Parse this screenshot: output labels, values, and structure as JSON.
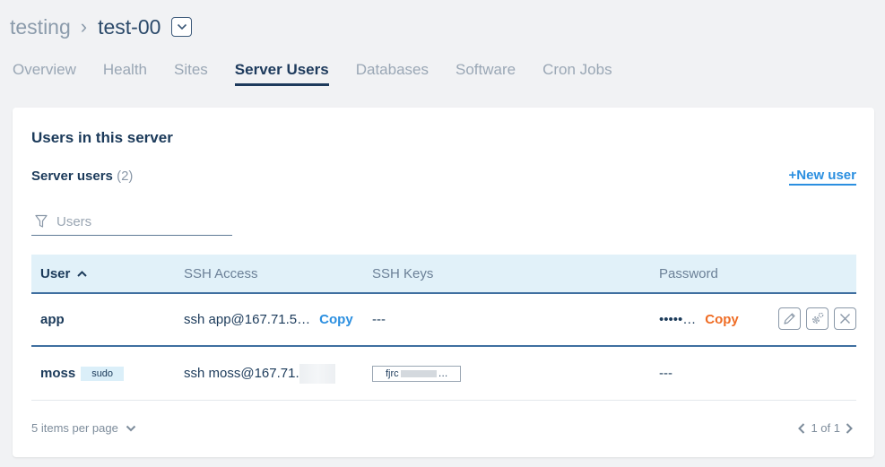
{
  "breadcrumb": {
    "parent": "testing",
    "separator": "›",
    "current": "test-00"
  },
  "tabs": [
    {
      "label": "Overview",
      "active": false
    },
    {
      "label": "Health",
      "active": false
    },
    {
      "label": "Sites",
      "active": false
    },
    {
      "label": "Server Users",
      "active": true
    },
    {
      "label": "Databases",
      "active": false
    },
    {
      "label": "Software",
      "active": false
    },
    {
      "label": "Cron Jobs",
      "active": false
    }
  ],
  "card": {
    "title": "Users in this server",
    "section_label": "Server users",
    "section_count": "(2)",
    "new_user_label": "+New user",
    "filter_placeholder": "Users"
  },
  "table": {
    "headers": {
      "user": "User",
      "ssh_access": "SSH Access",
      "ssh_keys": "SSH Keys",
      "password": "Password"
    },
    "rows": [
      {
        "user": "app",
        "badge": "",
        "ssh": "ssh app@167.71.5…",
        "ssh_copy": "Copy",
        "keys": "---",
        "password": "•••••…",
        "password_copy": "Copy"
      },
      {
        "user": "moss",
        "badge": "sudo",
        "ssh": "ssh moss@167.71.",
        "keys": "fjrc",
        "keys_suffix": "…",
        "password": "---"
      }
    ]
  },
  "footer": {
    "per_page": "5 items per page",
    "page_info": "1 of 1"
  },
  "colors": {
    "accent_blue": "#2b8fe0",
    "accent_orange": "#ef6c24",
    "header_bg": "#e1f1f9",
    "navy": "#1b3a5a"
  },
  "icons": [
    "chevron-down-icon",
    "filter-icon",
    "sort-ascending-icon",
    "edit-icon",
    "settings-icon",
    "close-icon",
    "chevron-left-icon",
    "chevron-right-icon"
  ]
}
